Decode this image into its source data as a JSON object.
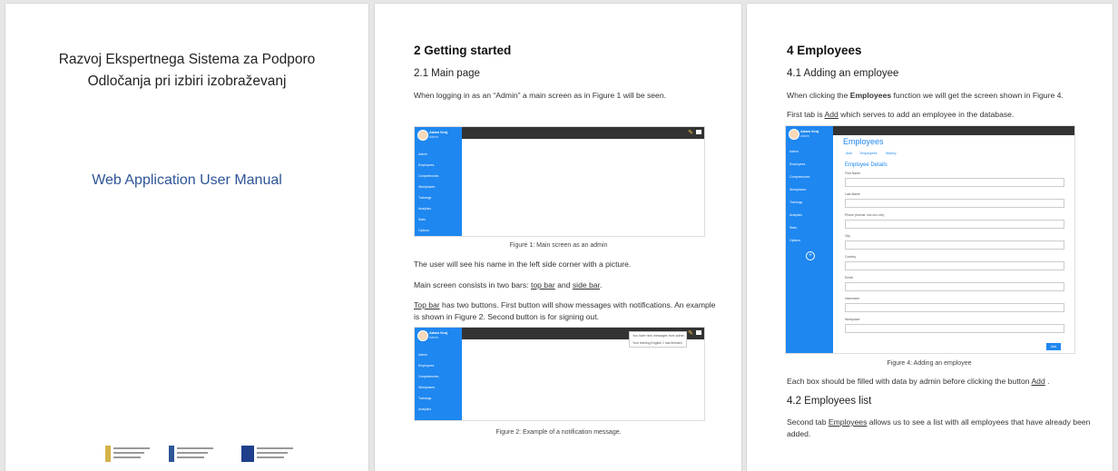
{
  "page1": {
    "title_line1": "Razvoj Ekspertnega Sistema za Podporo",
    "title_line2": "Odločanja pri izbiri izobraževanj",
    "subtitle": "Web Application User Manual"
  },
  "page2": {
    "h1": "2 Getting started",
    "h2": "2.1 Main page",
    "intro": "When logging in as an “Admin” a main screen as in Figure 1 will be seen.",
    "fig1_caption": "Figure 1: Main screen as an admin",
    "p_name": "The user will see his name in the left side corner with a picture.",
    "p_bars_pre": "Main screen consists in two bars: ",
    "p_bars_top": "top bar",
    "p_bars_and": " and ",
    "p_bars_side": "side bar",
    "p_bars_end": ".",
    "p_top_link": "Top bar",
    "p_top_rest": " has two buttons. First button will show messages with notifications. An example is shown in Figure 2. Second button is for signing out.",
    "fig2_caption": "Figure 2: Example of a notification message.",
    "app_user": "Adam Kraj",
    "app_role": "Admin",
    "menu1": [
      "Admin",
      "Employees",
      "Competencies",
      "Workplaces",
      "Trainings",
      "Analytics",
      "Stats",
      "Options"
    ],
    "menu2": [
      "Admin",
      "Employees",
      "Competencies",
      "Workplaces",
      "Trainings",
      "Analytics"
    ],
    "notif": [
      "You have new messages from admin",
      "Your training English 1 has finished"
    ]
  },
  "page3": {
    "h1": "4 Employees",
    "h2a": "4.1 Adding an employee",
    "p1_pre": "When clicking the ",
    "p1_bold": "Employees",
    "p1_post": " function we will get the screen shown in Figure 4.",
    "p2_pre": "First tab is ",
    "p2_link": "Add",
    "p2_post": " which serves to add an employee in the database.",
    "app_title": "Employees",
    "tabs": [
      "Add",
      "Employees",
      "History"
    ],
    "details": "Employee Details",
    "fields": [
      "First Name",
      "Last Name",
      "Phone (format: xxx-xxx-xxx)",
      "City",
      "Country",
      "Email",
      "Username",
      "Workplace"
    ],
    "add_btn": "Add",
    "fig4_caption": "Figure 4: Adding an employee",
    "p3_pre": "Each box should be filled with data by admin before clicking the button ",
    "p3_link": "Add",
    "p3_post": " .",
    "h2b": "4.2 Employees list",
    "p4_pre": "Second tab ",
    "p4_link": "Employees",
    "p4_post": " allows us to see a list with all employees that have already been added.",
    "app_user": "Adam Kraj",
    "app_role": "Admin",
    "menu": [
      "Admin",
      "Employees",
      "Competencies",
      "Workplaces",
      "Trainings",
      "Analytics",
      "Stats",
      "Options"
    ]
  }
}
